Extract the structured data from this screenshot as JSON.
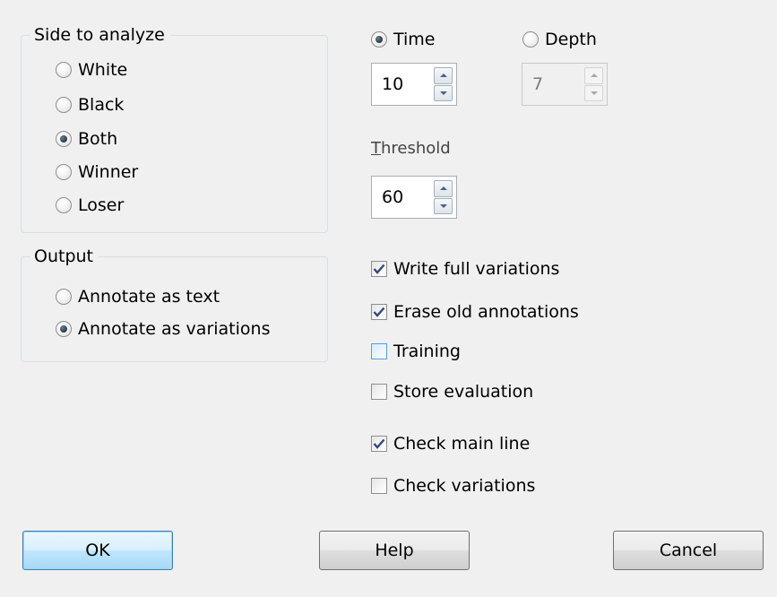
{
  "side_group": {
    "title": "Side to analyze",
    "options": [
      {
        "label": "White",
        "checked": false
      },
      {
        "label": "Black",
        "checked": false
      },
      {
        "label": "Both",
        "checked": true
      },
      {
        "label": "Winner",
        "checked": false
      },
      {
        "label": "Loser",
        "checked": false
      }
    ]
  },
  "output_group": {
    "title": "Output",
    "options": [
      {
        "label": "Annotate as text",
        "checked": false
      },
      {
        "label": "Annotate as variations",
        "checked": true
      }
    ]
  },
  "limit": {
    "time_label": "Time",
    "time_selected": true,
    "time_value": "10",
    "depth_label": "Depth",
    "depth_selected": false,
    "depth_value": "7"
  },
  "threshold": {
    "label_first": "T",
    "label_rest": "hreshold",
    "value": "60"
  },
  "checkboxes": [
    {
      "label": "Write full variations",
      "checked": true
    },
    {
      "label": "Erase old annotations",
      "checked": true
    },
    {
      "label": "Training",
      "checked": false,
      "focused": true
    },
    {
      "label": "Store evaluation",
      "checked": false
    },
    {
      "label": "Check main line",
      "checked": true
    },
    {
      "label": "Check variations",
      "checked": false
    }
  ],
  "buttons": {
    "ok": "OK",
    "help": "Help",
    "cancel": "Cancel"
  }
}
